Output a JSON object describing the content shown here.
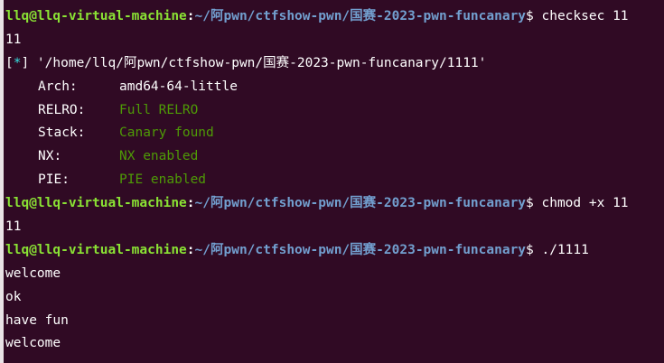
{
  "prompt": {
    "user_host": "llq@llq-virtual-machine",
    "colon": ":",
    "path": "~/阿pwn/ctfshow-pwn/国赛-2023-pwn-funcanary",
    "symbol": "$"
  },
  "lines": {
    "cmd1": " checksec 11",
    "cmd1_wrap": "11",
    "info_open": "[",
    "info_star": "*",
    "info_close": "]",
    "info_path": " '/home/llq/阿pwn/ctfshow-pwn/国赛-2023-pwn-funcanary/1111'",
    "arch_label": "Arch:",
    "arch_value": "amd64-64-little",
    "relro_label": "RELRO:",
    "relro_value": "Full RELRO",
    "stack_label": "Stack:",
    "stack_value": "Canary found",
    "nx_label": "NX:",
    "nx_value": "NX enabled",
    "pie_label": "PIE:",
    "pie_value": "PIE enabled",
    "cmd2": " chmod +x 11",
    "cmd2_wrap": "11",
    "cmd3": " ./1111",
    "out1": "welcome",
    "out2": "ok",
    "out3": "have fun",
    "out4": "welcome"
  }
}
